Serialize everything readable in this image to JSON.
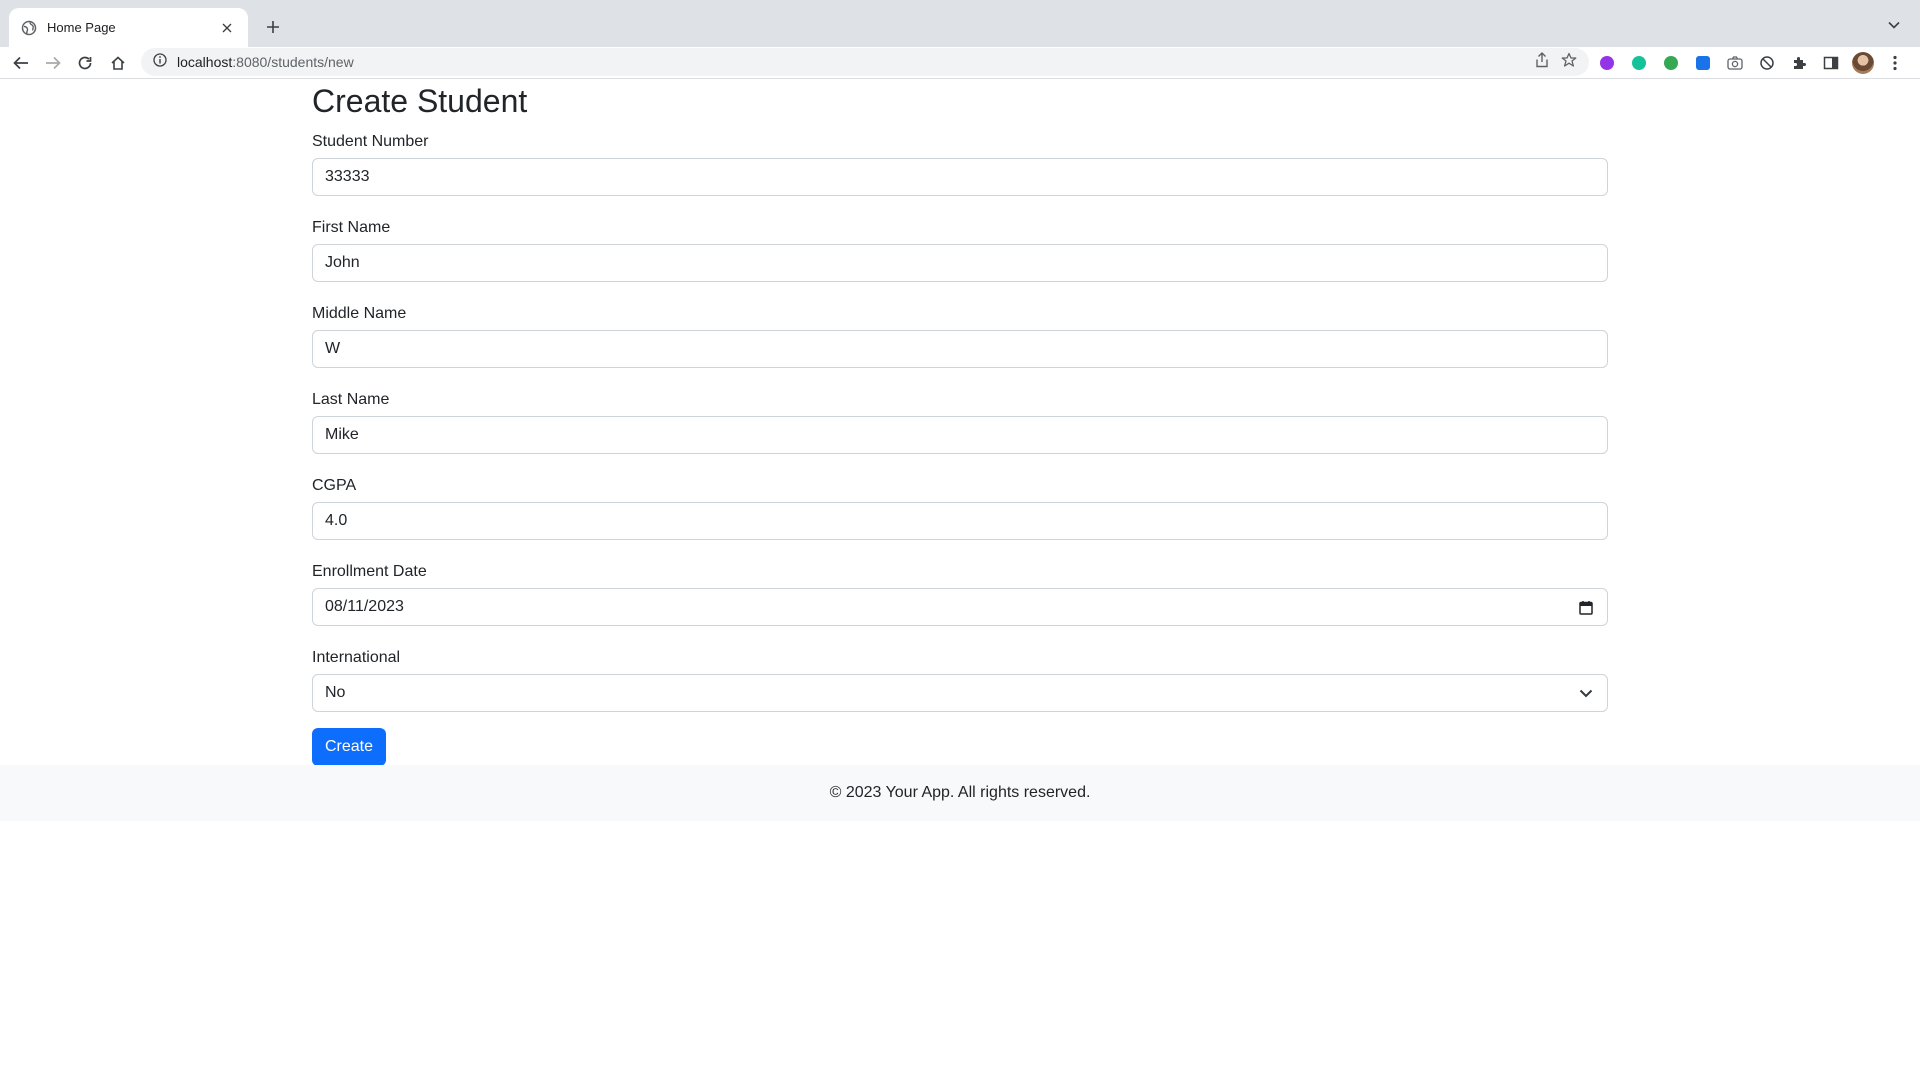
{
  "browser": {
    "tab_title": "Home Page",
    "url_host": "localhost",
    "url_rest": ":8080/students/new",
    "extension_colors": [
      "#9334e6",
      "#15c39a",
      "#34a853",
      "#1a73e8",
      "#5f6368",
      "#5f6368"
    ]
  },
  "page": {
    "title": "Create Student",
    "fields": [
      {
        "label": "Student Number",
        "value": "33333"
      },
      {
        "label": "First Name",
        "value": "John"
      },
      {
        "label": "Middle Name",
        "value": "W"
      },
      {
        "label": "Last Name",
        "value": "Mike"
      },
      {
        "label": "CGPA",
        "value": "4.0"
      },
      {
        "label": "Enrollment Date",
        "value": "08/11/2023"
      },
      {
        "label": "International",
        "value": "No"
      }
    ],
    "submit_label": "Create"
  },
  "footer": {
    "text": "© 2023 Your App. All rights reserved."
  },
  "colors": {
    "primary": "#0d6efd",
    "footer_bg": "#f8f9fa",
    "chrome_bg": "#dee1e6"
  }
}
